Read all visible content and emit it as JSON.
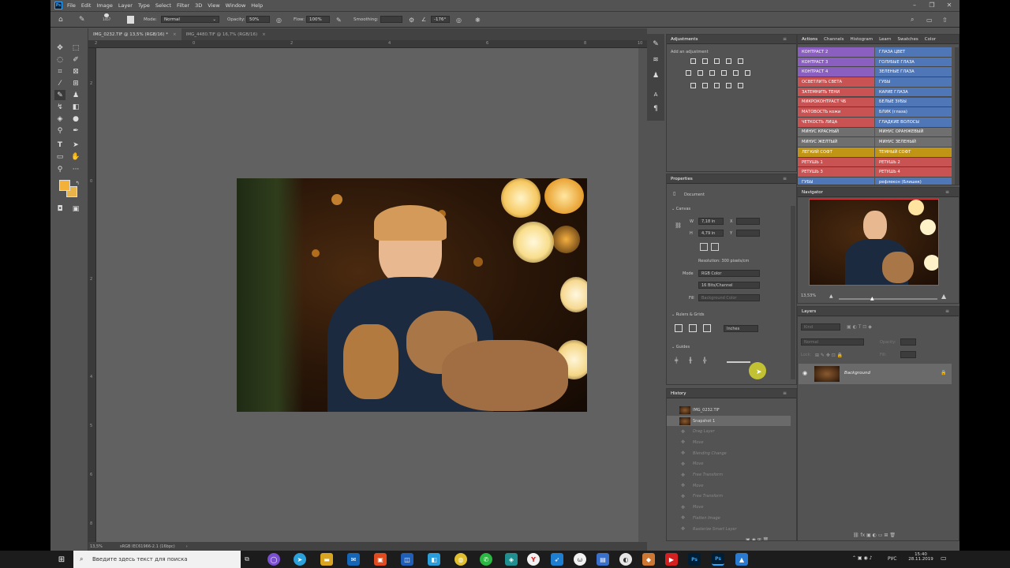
{
  "app": {
    "logo": "Ps",
    "menu": [
      "File",
      "Edit",
      "Image",
      "Layer",
      "Type",
      "Select",
      "Filter",
      "3D",
      "View",
      "Window",
      "Help"
    ],
    "window_controls": [
      "–",
      "❐",
      "✕"
    ]
  },
  "options": {
    "brush_size": "1457",
    "mode_label": "Mode:",
    "mode_value": "Normal",
    "opacity_label": "Opacity:",
    "opacity_value": "50%",
    "flow_label": "Flow:",
    "flow_value": "100%",
    "smoothing_label": "Smoothing:",
    "angle_value": "-176°"
  },
  "tabs": [
    {
      "label": "IMG_0232.TIF @ 13,5% (RGB/16) *",
      "close": "×"
    },
    {
      "label": "IMG_4480.TIF @ 16,7% (RGB/16)",
      "close": "×"
    }
  ],
  "ruler_top": [
    "2",
    "0",
    "2",
    "4",
    "6",
    "8",
    "10"
  ],
  "ruler_left": [
    "2",
    "0",
    "2",
    "4",
    "5",
    "6",
    "8"
  ],
  "statusbar": {
    "zoom": "13,5%",
    "profile": "sRGB IEC61966-2.1 (16bpc)",
    "arrow": "›"
  },
  "adjustments": {
    "title": "Adjustments",
    "add_label": "Add an adjustment"
  },
  "actions": {
    "tabs": [
      "Actions",
      "Channels",
      "Histogram",
      "Learn",
      "Swatches",
      "Color"
    ],
    "left": [
      {
        "label": "КОНТРАСТ 2",
        "color": "#8a5fc0"
      },
      {
        "label": "КОНТРАСТ 3",
        "color": "#8a5fc0"
      },
      {
        "label": "КОНТРАСТ 4",
        "color": "#8a5fc0"
      },
      {
        "label": "ОСВЕТЛИТЬ СВЕТА",
        "color": "#c95252"
      },
      {
        "label": "ЗАТЕМНИТЬ ТЕНИ",
        "color": "#c95252"
      },
      {
        "label": "МИКРОКОНТРАСТ ЧБ",
        "color": "#c95252"
      },
      {
        "label": "МАТОВОСТЬ кожи",
        "color": "#c95252"
      },
      {
        "label": "ЧЕТКОСТЬ ЛИЦА",
        "color": "#c95252"
      },
      {
        "label": "МИНУС КРАСНЫЙ",
        "color": "#6f6f6f"
      },
      {
        "label": "МИНУС ЖЕЛТЫЙ",
        "color": "#6f6f6f"
      },
      {
        "label": "ЛЕГКИЙ СОФТ",
        "color": "#c09515"
      },
      {
        "label": "РЕТУШЬ 1",
        "color": "#c95252"
      },
      {
        "label": "РЕТУШЬ 3",
        "color": "#c95252"
      },
      {
        "label": "ГУБЫ",
        "color": "#4f77b8"
      }
    ],
    "right": [
      {
        "label": "ГЛАЗА ЦВЕТ",
        "color": "#4f77b8"
      },
      {
        "label": "ГОЛУБЫЕ ГЛАЗА",
        "color": "#4f77b8"
      },
      {
        "label": "ЗЕЛЕНЫЕ ГЛАЗА",
        "color": "#4f77b8"
      },
      {
        "label": "ГУБЫ",
        "color": "#4f77b8"
      },
      {
        "label": "КАРИЕ ГЛАЗА",
        "color": "#4f77b8"
      },
      {
        "label": "БЕЛЫЕ ЗУБЫ",
        "color": "#4f77b8"
      },
      {
        "label": "БЛИК (глаза)",
        "color": "#4f77b8"
      },
      {
        "label": "ГЛАДКИЕ ВОЛОСЫ",
        "color": "#4f77b8"
      },
      {
        "label": "МИНУС ОРАНЖЕВЫЙ",
        "color": "#6f6f6f"
      },
      {
        "label": "МИНУС ЗЕЛЕНЫЙ",
        "color": "#6f6f6f"
      },
      {
        "label": "ТЕМНЫЙ СОФТ",
        "color": "#c09515"
      },
      {
        "label": "РЕТУШЬ 2",
        "color": "#c95252"
      },
      {
        "label": "РЕТУШЬ 4",
        "color": "#c95252"
      },
      {
        "label": "рефлексн (Блишек)",
        "color": "#4f77b8"
      }
    ]
  },
  "properties": {
    "title": "Properties",
    "document": "Document",
    "canvas": "Canvas",
    "w_label": "W",
    "w_value": "7,18 in",
    "h_label": "H",
    "h_value": "4,79 in",
    "x_label": "X",
    "y_label": "Y",
    "resolution": "Resolution: 300 pixels/cm",
    "mode_label": "Mode",
    "mode_value": "RGB Color",
    "depth_value": "16 Bits/Channel",
    "fill_label": "Fill",
    "fill_value": "Background Color",
    "rulers_grids": "Rulers & Grids",
    "units_value": "Inches",
    "guides": "Guides"
  },
  "navigator": {
    "title": "Navigator",
    "zoom": "13,53%"
  },
  "layers": {
    "title": "Layers",
    "kind_placeholder": "Kind",
    "blend": "Normal",
    "opacity_label": "Opacity:",
    "lock_label": "Lock:",
    "fill_label": "Fill:",
    "layer_name": "Background"
  },
  "history": {
    "title": "History",
    "items": [
      {
        "label": "IMG_0232.TIF",
        "active": false,
        "thumb": true
      },
      {
        "label": "Snapshot 1",
        "active": true,
        "thumb": true
      },
      {
        "label": "Drag Layer"
      },
      {
        "label": "Move"
      },
      {
        "label": "Blending Change"
      },
      {
        "label": "Move"
      },
      {
        "label": "Free Transform"
      },
      {
        "label": "Move"
      },
      {
        "label": "Free Transform"
      },
      {
        "label": "Move"
      },
      {
        "label": "Flatten Image"
      },
      {
        "label": "Rasterize Smart Layer"
      }
    ]
  },
  "taskbar": {
    "search_placeholder": "Введите здесь текст для поиска",
    "lang": "РУС",
    "time": "15:40",
    "date": "28.11.2019"
  },
  "colors": {
    "foreground": "#f3b13a",
    "background": "#e8b44a",
    "accent": "#31a8ff"
  }
}
